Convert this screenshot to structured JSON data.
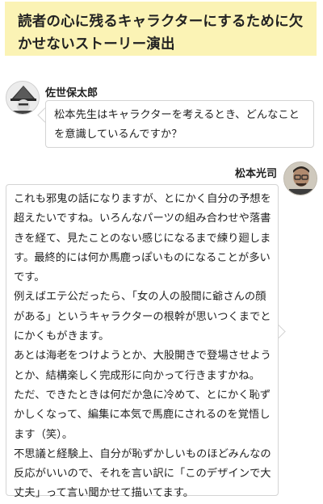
{
  "article": {
    "heading": "読者の心に残るキャラクターにするために欠かせないストーリー演出"
  },
  "dialogue": {
    "interviewer": {
      "name": "佐世保太郎",
      "avatar_icon": "samurai-kasa-avatar",
      "message": "松本先生はキャラクターを考えるとき、どんなことを意識しているんですか？"
    },
    "artist": {
      "name": "松本光司",
      "avatar_icon": "man-with-glasses-avatar",
      "paragraphs": [
        "これも邪鬼の話になりますが、とにかく自分の予想を超えたいですね。いろんなパーツの組み合わせや落書きを経て、見たことのない感じになるまで練り廻します。最終的には何か馬鹿っぽいものになることが多いです。",
        "例えばエテ公だったら、「女の人の股間に爺さんの顔がある」というキャラクターの根幹が思いつくまでとにかくもがきます。",
        "あとは海老をつけようとか、大股開きで登場させようとか、結構楽しく完成形に向かって行きますかね。",
        "ただ、できたときは何だか急に冷めて、とにかく恥ずかしくなって、編集に本気で馬鹿にされるのを覚悟します（笑）。",
        "不思議と経験上、自分が恥ずかしいものほどみんなの反応がいいので、それを言い訳に「このデザインで大丈夫」って言い聞かせて描いてます。"
      ]
    }
  }
}
